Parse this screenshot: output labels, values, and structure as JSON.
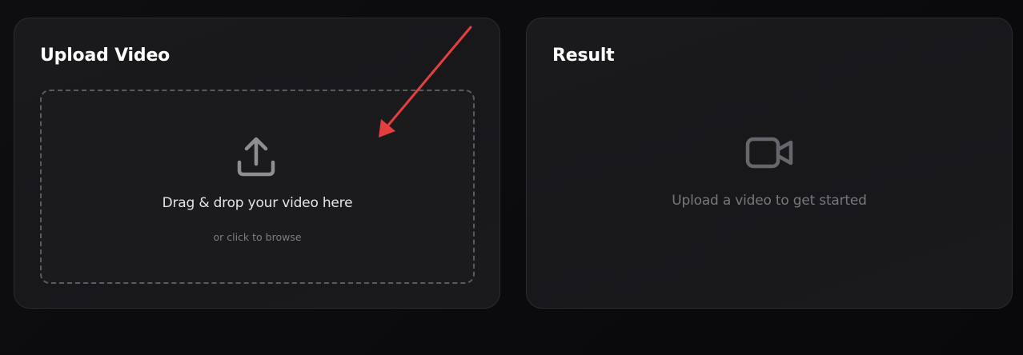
{
  "upload_panel": {
    "title": "Upload Video",
    "dropzone": {
      "primary_text": "Drag & drop your video here",
      "secondary_text": "or click to browse",
      "icon": "upload-icon"
    }
  },
  "result_panel": {
    "title": "Result",
    "placeholder_text": "Upload a video to get started",
    "icon": "video-camera-icon"
  },
  "annotation": {
    "type": "arrow",
    "color": "#e53e3e"
  },
  "colors": {
    "background": "#0c0c0e",
    "panel": "#1a1a1d",
    "panel_border": "#2c2c31",
    "dropzone_border": "#5a5a60",
    "icon": "#8e8e94",
    "muted_text": "#77777e"
  }
}
